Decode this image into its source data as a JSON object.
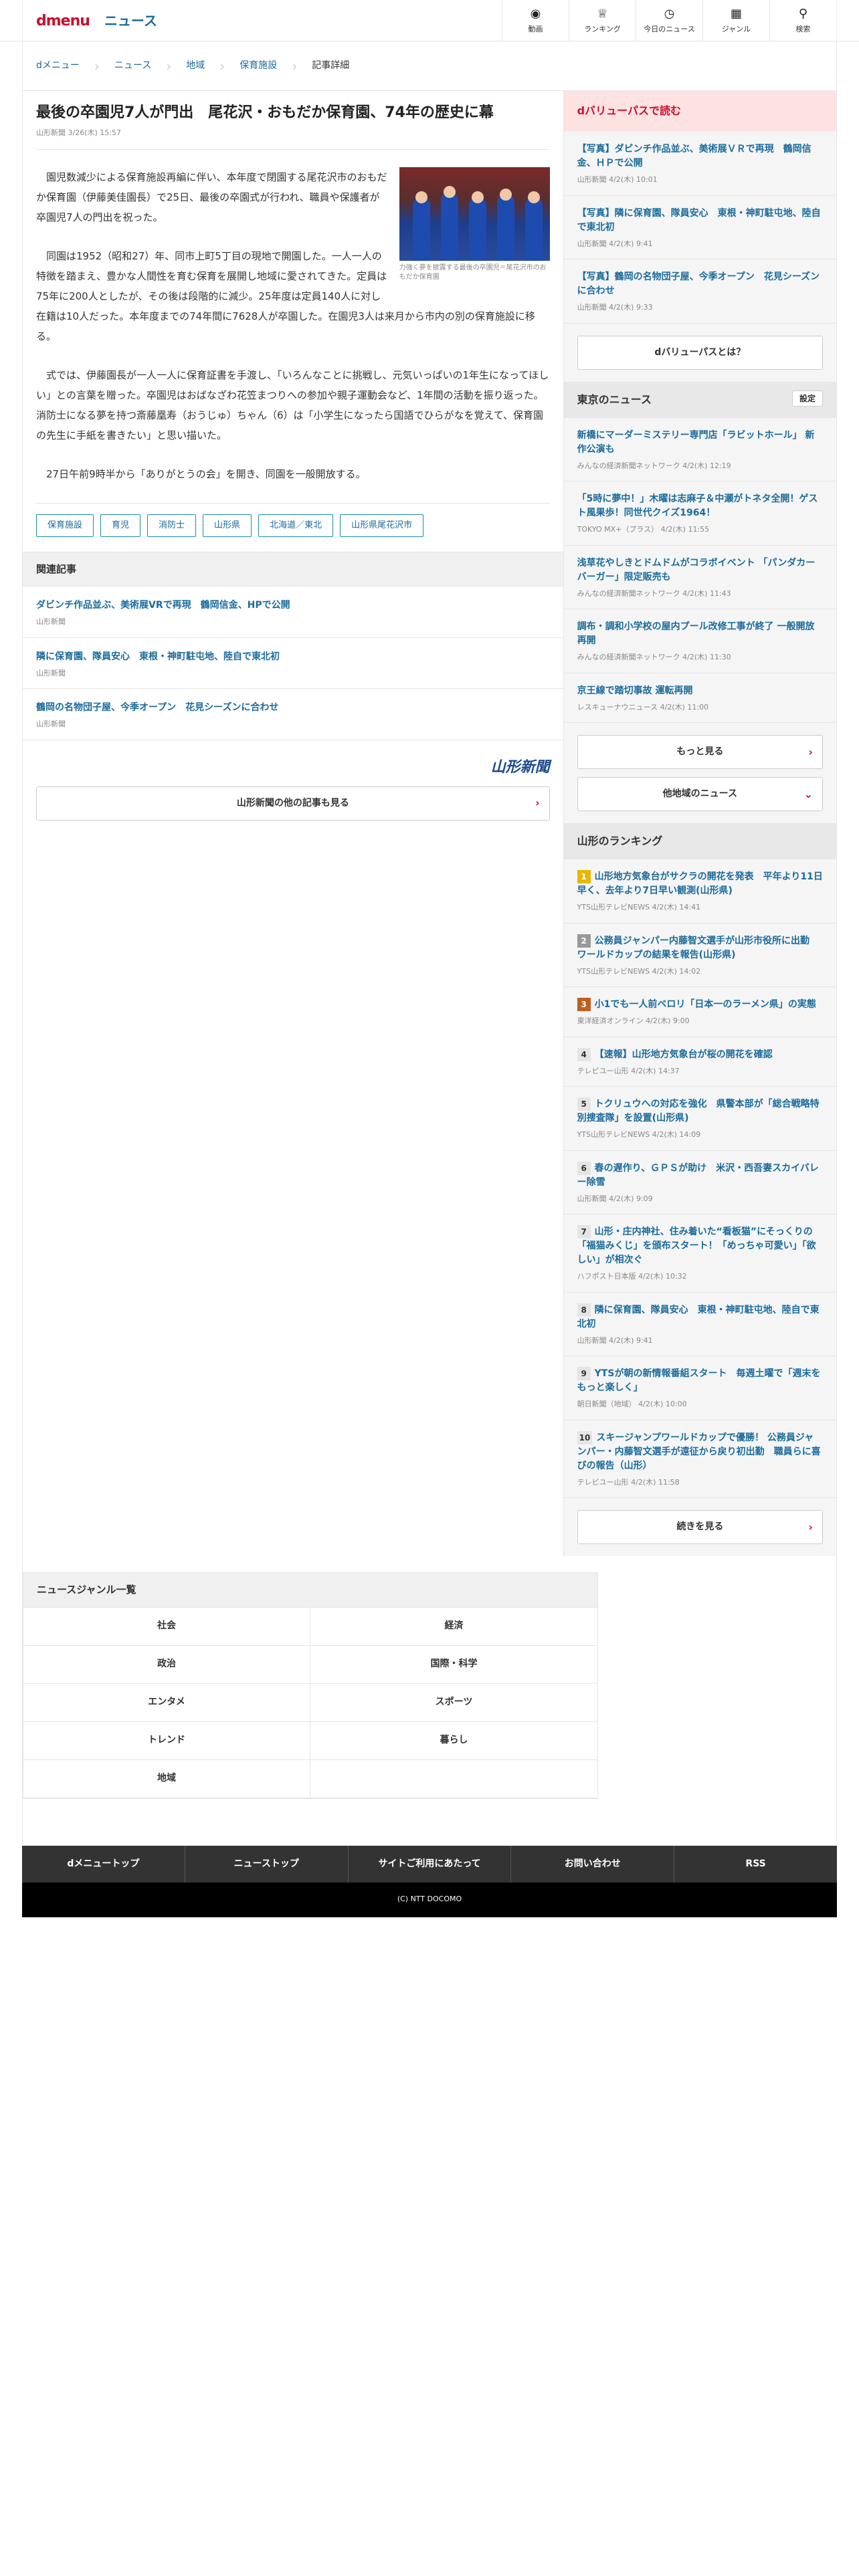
{
  "header": {
    "logo": "dmenu",
    "section": "ニュース",
    "nav": [
      {
        "label": "動画",
        "icon": "video-camera-icon"
      },
      {
        "label": "ランキング",
        "icon": "trophy-icon"
      },
      {
        "label": "今日のニュース",
        "icon": "clock-icon"
      },
      {
        "label": "ジャンル",
        "icon": "grid-icon"
      },
      {
        "label": "検索",
        "icon": "search-icon"
      }
    ]
  },
  "breadcrumb": [
    "dメニュー",
    "ニュース",
    "地域",
    "保育施設",
    "記事詳細"
  ],
  "article": {
    "title": "最後の卒園児7人が門出　尾花沢・おもだか保育園、74年の歴史に幕",
    "meta": "山形新聞 3/26(木) 15:57",
    "photo_caption": "力強く夢を披露する最後の卒園児＝尾花沢市のおもだか保育園",
    "paragraphs": [
      "園児数減少による保育施設再編に伴い、本年度で閉園する尾花沢市のおもだか保育園（伊藤美佳園長）で25日、最後の卒園式が行われ、職員や保護者が卒園児7人の門出を祝った。",
      "同園は1952（昭和27）年、同市上町5丁目の現地で開園した。一人一人の特徴を踏まえ、豊かな人間性を育む保育を展開し地域に愛されてきた。定員は75年に200人としたが、その後は段階的に減少。25年度は定員140人に対し在籍は10人だった。本年度までの74年間に7628人が卒園した。在園児3人は来月から市内の別の保育施設に移る。",
      "式では、伊藤園長が一人一人に保育証書を手渡し、「いろんなことに挑戦し、元気いっぱいの1年生になってほしい」との言葉を贈った。卒園児はおばなざわ花笠まつりへの参加や親子運動会など、1年間の活動を振り返った。消防士になる夢を持つ斎藤凰寿（おうじゅ）ちゃん（6）は「小学生になったら国語でひらがなを覚えて、保育園の先生に手紙を書きたい」と思い描いた。",
      "27日午前9時半から「ありがとうの会」を開き、同園を一般開放する。"
    ],
    "tags": [
      "保育施設",
      "育児",
      "消防士",
      "山形県",
      "北海道／東北",
      "山形県尾花沢市"
    ]
  },
  "related": {
    "heading": "関連記事",
    "items": [
      {
        "title": "ダビンチ作品並ぶ、美術展VRで再現　鶴岡信金、HPで公開",
        "source": "山形新聞"
      },
      {
        "title": "隣に保育園、隊員安心　東根・神町駐屯地、陸自で東北初",
        "source": "山形新聞"
      },
      {
        "title": "鶴岡の名物団子屋、今季オープン　花見シーズンに合わせ",
        "source": "山形新聞"
      }
    ],
    "publisher_logo": "山形新聞",
    "more_label": "山形新聞の他の記事も見る"
  },
  "sidebar": {
    "dvalue": {
      "heading": "dバリューパスで読む",
      "items": [
        {
          "title": "【写真】ダビンチ作品並ぶ、美術展ＶＲで再現　鶴岡信金、ＨＰで公開",
          "meta": "山形新聞 4/2(木) 10:01"
        },
        {
          "title": "【写真】隣に保育園、隊員安心　東根・神町駐屯地、陸自で東北初",
          "meta": "山形新聞 4/2(木) 9:41"
        },
        {
          "title": "【写真】鶴岡の名物団子屋、今季オープン　花見シーズンに合わせ",
          "meta": "山形新聞 4/2(木) 9:33"
        }
      ],
      "button": "dバリューパスとは？"
    },
    "tokyo": {
      "heading": "東京のニュース",
      "setting": "設定",
      "items": [
        {
          "title": "新橋にマーダーミステリー専門店「ラビットホール」 新作公演も",
          "meta": "みんなの経済新聞ネットワーク 4/2(木) 12:19"
        },
        {
          "title": "「5時に夢中！」木曜は志麻子＆中瀬がトネタ全開！ゲスト風果歩！同世代クイズ1964！",
          "meta": "TOKYO MX+（プラス） 4/2(木) 11:55"
        },
        {
          "title": "浅草花やしきとドムドムがコラボイベント 「パンダカーバーガー」限定販売も",
          "meta": "みんなの経済新聞ネットワーク 4/2(木) 11:43"
        },
        {
          "title": "調布・調和小学校の屋内プール改修工事が終了 一般開放再開",
          "meta": "みんなの経済新聞ネットワーク 4/2(木) 11:30"
        },
        {
          "title": "京王線で踏切事故 運転再開",
          "meta": "レスキューナウニュース 4/2(木) 11:00"
        }
      ],
      "more": "もっと見る",
      "other": "他地域のニュース"
    },
    "ranking": {
      "heading": "山形のランキング",
      "items": [
        {
          "rank": "1",
          "title": "山形地方気象台がサクラの開花を発表　平年より11日早く、去年より7日早い観測(山形県)",
          "meta": "YTS山形テレビNEWS 4/2(木) 14:41"
        },
        {
          "rank": "2",
          "title": "公務員ジャンパー内藤智文選手が山形市役所に出勤　ワールドカップの結果を報告(山形県)",
          "meta": "YTS山形テレビNEWS 4/2(木) 14:02"
        },
        {
          "rank": "3",
          "title": "小1でも一人前ベロリ「日本一のラーメン県」の実態",
          "meta": "東洋経済オンライン 4/2(木) 9:00"
        },
        {
          "rank": "4",
          "title": "【速報】山形地方気象台が桜の開花を確認",
          "meta": "テレビユー山形 4/2(木) 14:37"
        },
        {
          "rank": "5",
          "title": "トクリュウへの対応を強化　県警本部が「総合戦略特別捜査隊」を設置(山形県)",
          "meta": "YTS山形テレビNEWS 4/2(木) 14:09"
        },
        {
          "rank": "6",
          "title": "春の遅作り、ＧＰＳが助け　米沢・西吾妻スカイバレー除雪",
          "meta": "山形新聞 4/2(木) 9:09"
        },
        {
          "rank": "7",
          "title": "山形・庄内神社、住み着いた“看板猫”にそっくりの「福猫みくじ」を頒布スタート！「めっちゃ可愛い」「欲しい」が相次ぐ",
          "meta": "ハフポスト日本版 4/2(木) 10:32"
        },
        {
          "rank": "8",
          "title": "隣に保育園、隊員安心　東根・神町駐屯地、陸自で東北初",
          "meta": "山形新聞 4/2(木) 9:41"
        },
        {
          "rank": "9",
          "title": "YTSが朝の新情報番組スタート　毎週土曜で「週末をもっと楽しく」",
          "meta": "朝日新聞（地域） 4/2(木) 10:00"
        },
        {
          "rank": "10",
          "title": "スキージャンプワールドカップで優勝！ 公務員ジャンパー・内藤智文選手が遠征から戻り初出勤　職員らに喜びの報告（山形）",
          "meta": "テレビユー山形 4/2(木) 11:58"
        }
      ],
      "more": "続きを見る"
    }
  },
  "genres": {
    "heading": "ニュースジャンル一覧",
    "items": [
      "社会",
      "経済",
      "政治",
      "国際・科学",
      "エンタメ",
      "スポーツ",
      "トレンド",
      "暮らし",
      "地域"
    ]
  },
  "footer": {
    "links": [
      "dメニュートップ",
      "ニューストップ",
      "サイトご利用にあたって",
      "お問い合わせ",
      "RSS"
    ],
    "copyright": "(C) NTT DOCOMO"
  }
}
